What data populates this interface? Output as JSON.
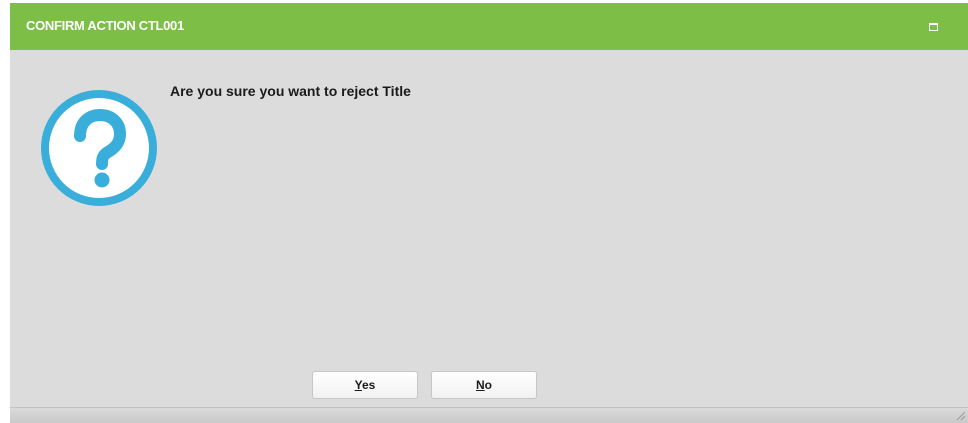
{
  "dialog": {
    "title": "CONFIRM ACTION CTL001",
    "message": "Are you sure you want to reject Title",
    "buttons": {
      "yes_label": "Yes",
      "no_label": "No"
    },
    "icons": {
      "main": "question-circle-icon",
      "maximize": "maximize-icon",
      "resize": "resize-grip-icon"
    }
  },
  "colors": {
    "titlebar": "#7dbe47",
    "body": "#dcdcdc",
    "icon_accent": "#3aaedb"
  }
}
